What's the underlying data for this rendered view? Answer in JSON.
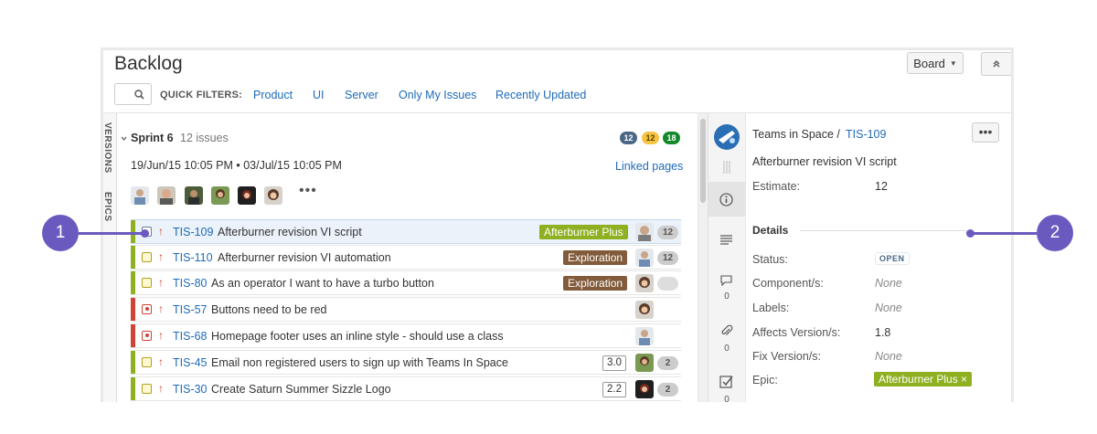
{
  "header": {
    "title": "Backlog",
    "board_label": "Board",
    "collapse_label": "«"
  },
  "quick_filters": {
    "label": "QUICK FILTERS:",
    "items": [
      "Product",
      "UI",
      "Server",
      "Only My Issues",
      "Recently Updated"
    ]
  },
  "side_tabs": [
    "VERSIONS",
    "EPICS"
  ],
  "sprint": {
    "name": "Sprint 6",
    "count": "12 issues",
    "badges": [
      {
        "value": "12",
        "color": "#4a6785"
      },
      {
        "value": "12",
        "color": "#f6c342"
      },
      {
        "value": "18",
        "color": "#14892c"
      }
    ],
    "dates": "19/Jun/15 10:05 PM • 03/Jul/15 10:05 PM",
    "linked_pages": "Linked pages",
    "more": "•••"
  },
  "issues": [
    {
      "key": "TIS-109",
      "title": "Afterburner revision VI script",
      "type": "story",
      "epic": "Afterburner Plus",
      "epic_color": "#8eb021",
      "estimate": "",
      "points": "12",
      "bar": "#8eb021",
      "selected": true
    },
    {
      "key": "TIS-110",
      "title": "Afterburner revision VI automation",
      "type": "story",
      "epic": "Exploration",
      "epic_color": "#815b3a",
      "estimate": "",
      "points": "12",
      "bar": "#8eb021",
      "selected": false
    },
    {
      "key": "TIS-80",
      "title": "As an operator I want to have a turbo button",
      "type": "story",
      "epic": "Exploration",
      "epic_color": "#815b3a",
      "estimate": "",
      "points": "",
      "bar": "#8eb021",
      "selected": false
    },
    {
      "key": "TIS-57",
      "title": "Buttons need to be red",
      "type": "bug",
      "epic": "",
      "epic_color": "",
      "estimate": "",
      "points": "",
      "bar": "#d04437",
      "selected": false
    },
    {
      "key": "TIS-68",
      "title": "Homepage footer uses an inline style - should use a class",
      "type": "bug",
      "epic": "",
      "epic_color": "",
      "estimate": "",
      "points": "",
      "bar": "#d04437",
      "selected": false
    },
    {
      "key": "TIS-45",
      "title": "Email non registered users to sign up with Teams In Space",
      "type": "story",
      "epic": "",
      "epic_color": "",
      "estimate": "3.0",
      "points": "2",
      "bar": "#8eb021",
      "selected": false
    },
    {
      "key": "TIS-30",
      "title": "Create Saturn Summer Sizzle Logo",
      "type": "story",
      "epic": "",
      "epic_color": "",
      "estimate": "2.2",
      "points": "2",
      "bar": "#8eb021",
      "selected": false
    }
  ],
  "detail": {
    "project": "Teams in Space",
    "separator": "/",
    "key": "TIS-109",
    "more": "•••",
    "summary": "Afterburner revision VI script",
    "estimate_label": "Estimate:",
    "estimate_value": "12",
    "section": "Details",
    "status_label": "Status:",
    "status_value": "OPEN",
    "component_label": "Component/s:",
    "component_value": "None",
    "labels_label": "Labels:",
    "labels_value": "None",
    "affects_label": "Affects Version/s:",
    "affects_value": "1.8",
    "fix_label": "Fix Version/s:",
    "fix_value": "None",
    "epic_label": "Epic:",
    "epic_value": "Afterburner Plus ×"
  },
  "rail": {
    "comments_count": "0",
    "attachments_count": "0",
    "subtasks_count": "0"
  },
  "callouts": [
    "1",
    "2"
  ],
  "colors": {
    "link": "#1e6bb8",
    "callout": "#6a5ac0",
    "story_bar": "#8eb021",
    "bug_bar": "#d04437"
  }
}
